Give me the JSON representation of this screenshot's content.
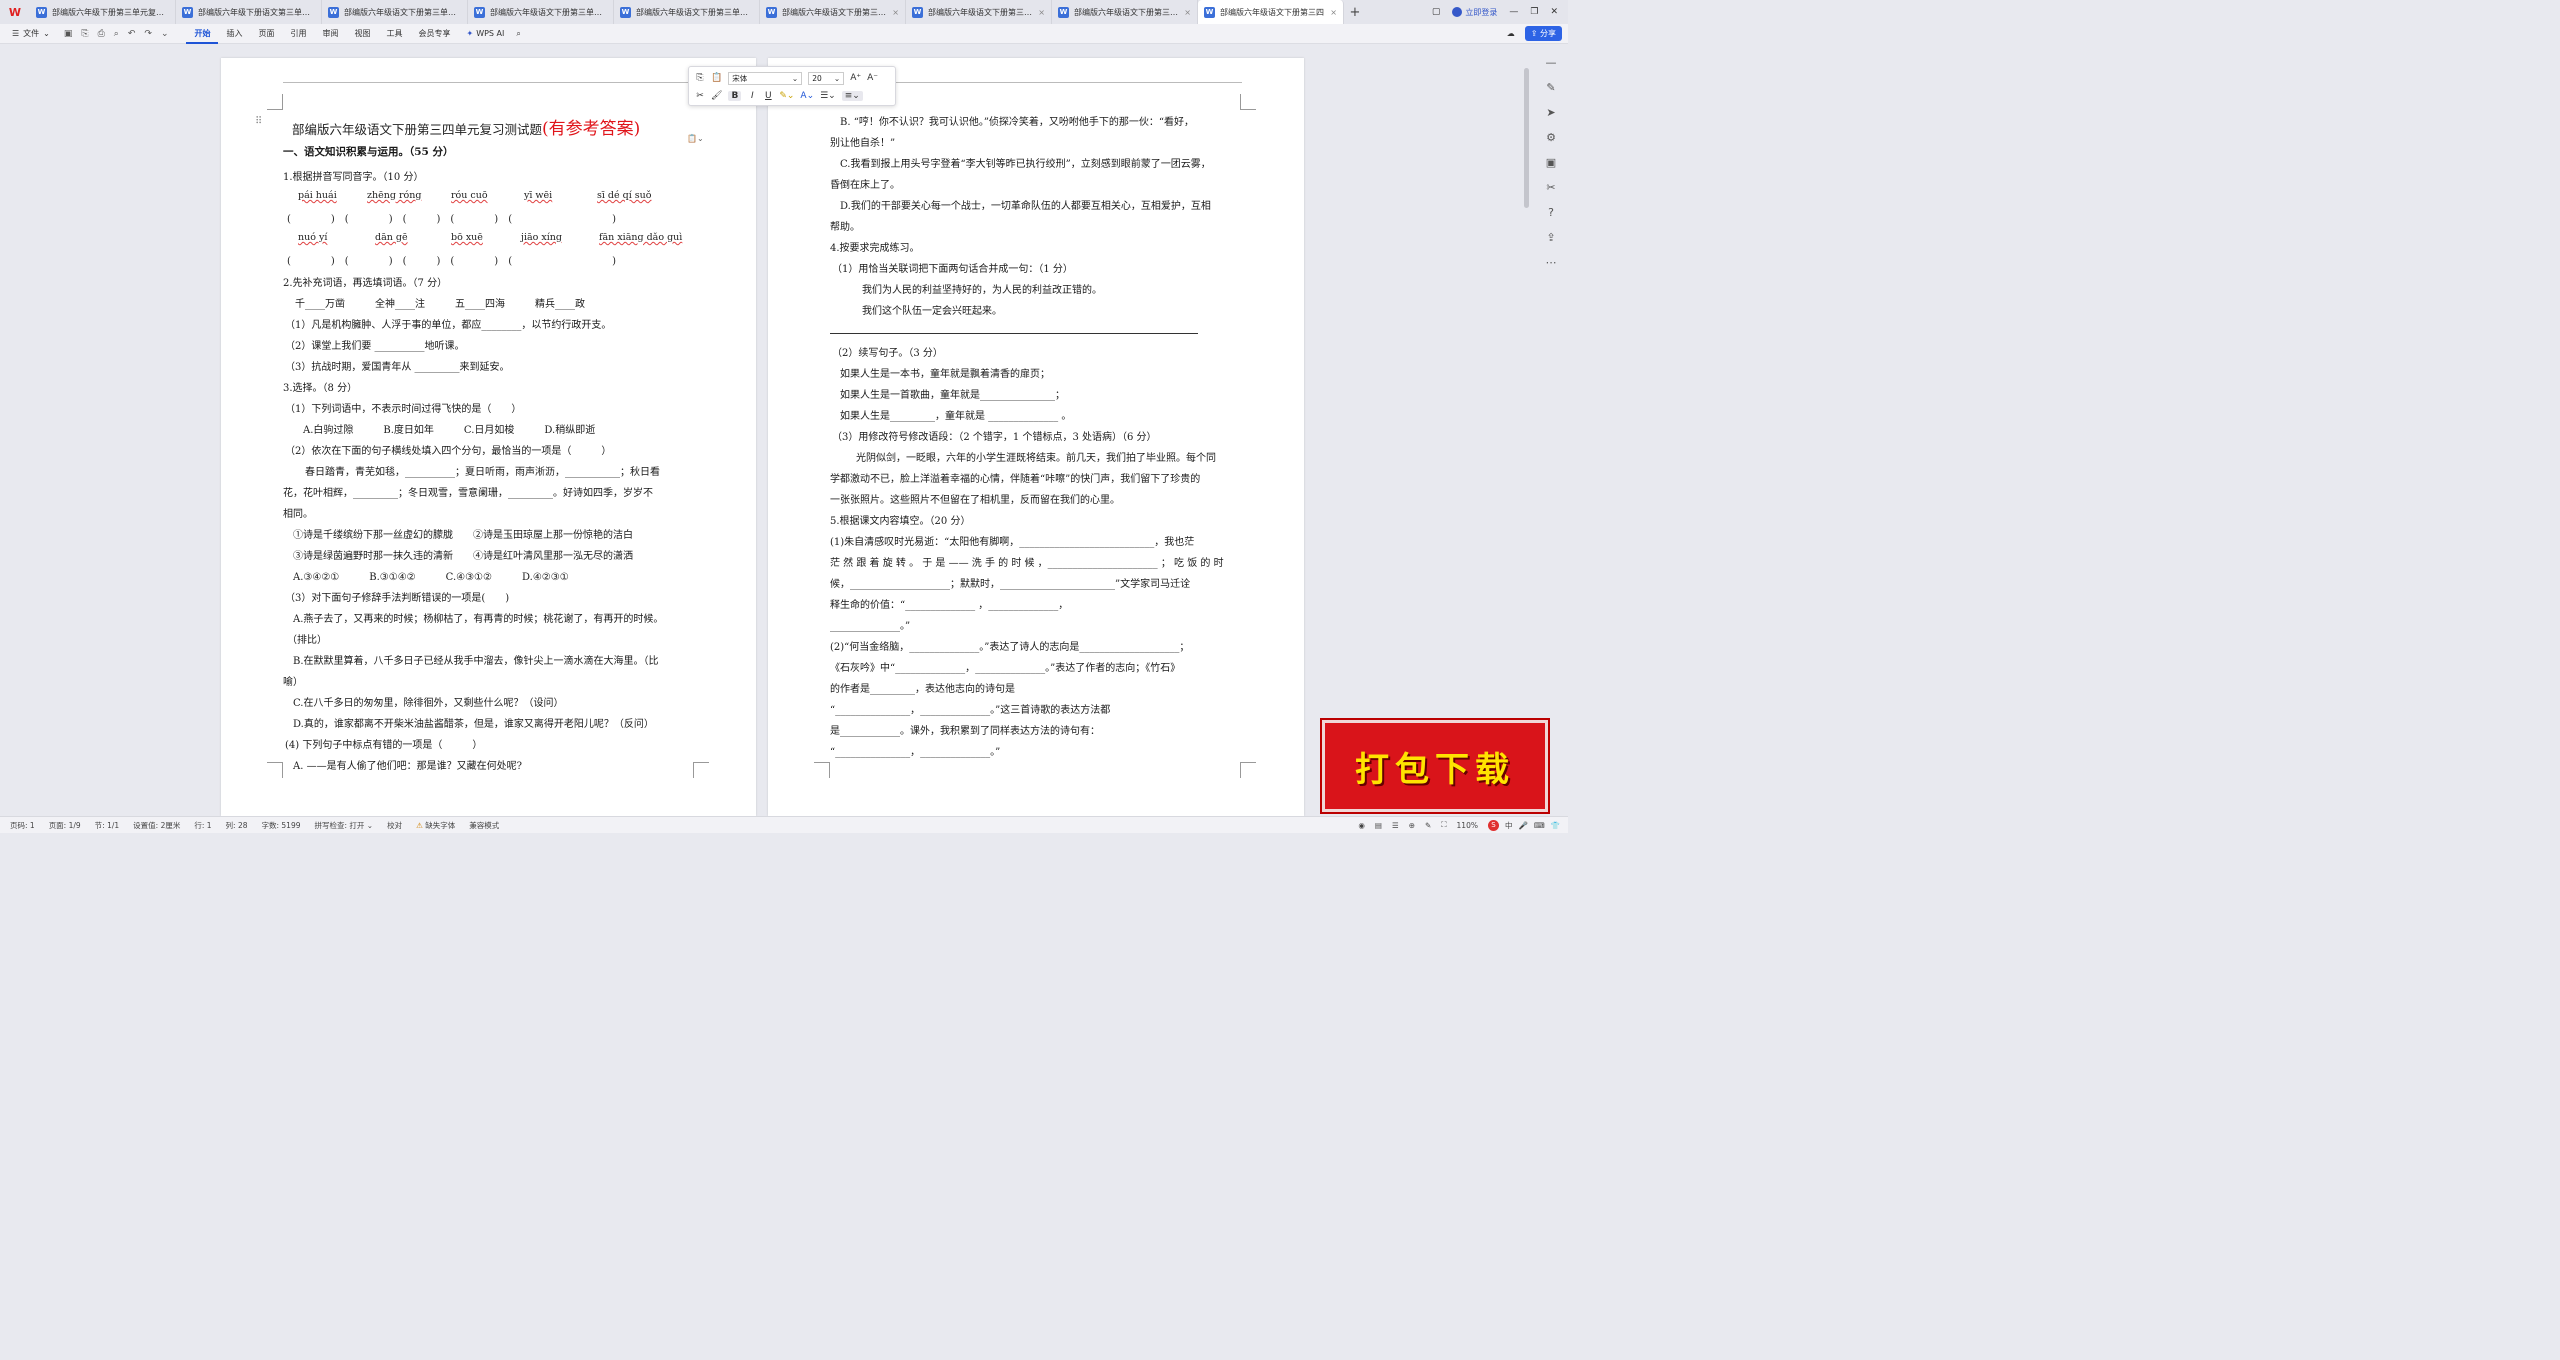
{
  "tabs": [
    {
      "label": "部编版六年级下册第三单元复习卷.d"
    },
    {
      "label": "部编版六年级下册语文第三单元测试"
    },
    {
      "label": "部编版六年级语文下册第三单元测试"
    },
    {
      "label": "部编版六年级语文下册第三单元习"
    },
    {
      "label": "部编版六年级语文下册第三单元复习"
    },
    {
      "label": "部编版六年级语文下册第三单元测"
    },
    {
      "label": "部编版六年级语文下册第三单元测"
    },
    {
      "label": "部编版六年级语文下册第三单元综合"
    },
    {
      "label": "部编版六年级语文下册第三四"
    }
  ],
  "header": {
    "login": "立即登录",
    "share": "分享"
  },
  "menu": {
    "file": "文件",
    "items": [
      "开始",
      "插入",
      "页面",
      "引用",
      "审阅",
      "视图",
      "工具",
      "会员专享"
    ],
    "ai": "WPS AI"
  },
  "mini_toolbar": {
    "font": "宋体",
    "size": "20",
    "bold": "B",
    "italic": "I",
    "underline": "U"
  },
  "left_page": {
    "title": "部编版六年级语文下册第三四单元复习测试题",
    "title_answer": "(有参考答案)",
    "section1": "一、语文知识积累与运用。（55 分）",
    "q1": "1.根据拼音写同音字。（10 分）",
    "pinyin_row1": [
      "pái  huái",
      "zhēng  róng",
      "róu  cuō",
      "yī  wēi",
      "sī  dé  qí  suǒ"
    ],
    "pinyin_row2": [
      "nuó  yí",
      "dān  gē",
      "bō  xuē",
      "jiāo  xíng",
      "fān xiāng dǎo guì"
    ],
    "paren_row": "(　　　　)　(　　　　)　(　　　)　(　　　　)　(　　　　　　　　　　)",
    "q2": "2.先补充词语，再选填词语。（7 分）",
    "q2_words": "千____万凿　　　全神____注　　　五____四海　　　精兵____政",
    "q2_1": "（1）凡是机构臃肿、人浮于事的单位，都应________，以节约行政开支。",
    "q2_2": "（2）课堂上我们要 __________地听课。",
    "q2_3": "（3）抗战时期，爱国青年从 _________来到延安。",
    "q3": "3.选择。（8 分）",
    "q3_1": "（1）下列词语中，不表示时间过得飞快的是（　　）",
    "q3_1_opts": "A.白驹过隙　　　B.度日如年　　　C.日月如梭　　　D.稍纵即逝",
    "q3_2": "（2）依次在下面的句子横线处填入四个分句，最恰当的一项是（　　　）",
    "q3_2_a": "春日踏青，青芜如毯，__________；夏日听雨，雨声淅沥，___________；秋日看",
    "q3_2_b": "花，花叶相辉，_________；冬日观雪，雪意阑珊，_________。好诗如四季，岁岁不",
    "q3_2_c": "相同。",
    "q3_2_s1": "①诗是千缕缤纷下那一丝虚幻的朦胧　　②诗是玉田琼屋上那一份惊艳的洁白",
    "q3_2_s2": "③诗是绿茵遍野时那一抹久违的清新　　④诗是红叶清风里那一泓无尽的潇洒",
    "q3_2_opts": "A.③④②①　　　B.③①④②　　　C.④③①②　　　D.④②③①",
    "q3_3": "（3）对下面句子修辞手法判断错误的一项是(　　)",
    "q3_3_a1": "A.燕子去了，又再来的时候；杨柳枯了，有再青的时候；桃花谢了，有再开的时候。",
    "q3_3_a2": "（排比）",
    "q3_3_b1": "B.在默默里算着，八千多日子已经从我手中溜去，像针尖上一滴水滴在大海里。（比",
    "q3_3_b2": "喻）",
    "q3_3_c": "C.在八千多日的匆匆里，除徘徊外，又剩些什么呢？（设问）",
    "q3_3_d": "D.真的，谁家都离不开柴米油盐酱醋茶，但是，谁家又离得开老阳儿呢？（反问）",
    "q3_4": "(4)  下列句子中标点有错的一项是（　　　）",
    "q3_4_a": "A.  ——是有人偷了他们吧：那是谁？又藏在何处呢?"
  },
  "right_page": {
    "b": "B.  “哼！你不认识？我可认识他。”侦探冷笑着，又吩咐他手下的那一伙：“看好，",
    "b2": "别让他自杀！”",
    "c1": "C.我看到报上用头号字登着“李大钊等昨已执行绞刑”，立刻感到眼前蒙了一团云雾，",
    "c2": "昏倒在床上了。",
    "d1": "D.我们的干部要关心每一个战士，一切革命队伍的人都要互相关心，互相爱护，互相",
    "d2": "帮助。",
    "q4": "4.按要求完成练习。",
    "q4_1": "（1）用恰当关联词把下面两句话合并成一句：（1 分）",
    "q4_1_a": "我们为人民的利益坚持好的，为人民的利益改正错的。",
    "q4_1_b": "我们这个队伍一定会兴旺起来。",
    "q4_2": "（2）续写句子。（3 分）",
    "q4_2_a": "如果人生是一本书，童年就是飘着清香的扉页；",
    "q4_2_b": "如果人生是一首歌曲，童年就是_______________；",
    "q4_2_c": "如果人生是_________，童年就是 ______________ 。",
    "q4_3": "（3）用修改符号修改语段：（2 个错字，1 个错标点，3 处语病）（6 分）",
    "q4_3_a": "光阴似剑，一眨眼，六年的小学生涯既将结束。前几天，我们拍了毕业照。每个同",
    "q4_3_b": "学都激动不已，脸上洋溢着幸福的心情，伴随着“咔嚓”的快门声，我们留下了珍贵的",
    "q4_3_c": "一张张照片。这些照片不但留在了相机里，反而留在我们的心里。",
    "q5": "5.根据课文内容填空。（20 分）",
    "q5_1a": "(1)朱自清感叹时光易逝：“太阳他有脚啊，___________________________，我也茫",
    "q5_1b": "茫 然 跟 着 旋 转 。 于 是 —— 洗 手 的 时 候 ，______________________ ； 吃 饭 的 时",
    "q5_1c": "候，____________________；默默时，_______________________”文学家司马迁诠",
    "q5_1d": "释生命的价值：“______________ ，______________，",
    "q5_1e": "______________。”",
    "q5_2a": "(2)“何当金络脑，______________。”表达了诗人的志向是____________________；",
    "q5_2b": "《石灰吟》中“______________，______________。”表达了作者的志向；《竹石》",
    "q5_2c": "的作者是_________，表达他志向的诗句是",
    "q5_2d": "“_______________，______________。”这三首诗歌的表达方法都",
    "q5_2e": "是____________。课外，我积累到了同样表达方法的诗句有：",
    "q5_2f": "“_______________，______________。”"
  },
  "statusbar": {
    "page": "页码: 1",
    "pages": "页面: 1/9",
    "section": "节: 1/1",
    "setting": "设置值: 2厘米",
    "row": "行: 1",
    "col": "列: 28",
    "words": "字数: 5199",
    "spell": "拼写检查: 打开",
    "proof": "校对",
    "missing_font": "缺失字体",
    "compat": "兼容模式",
    "zoom": "110%"
  },
  "promo": "打包下载"
}
